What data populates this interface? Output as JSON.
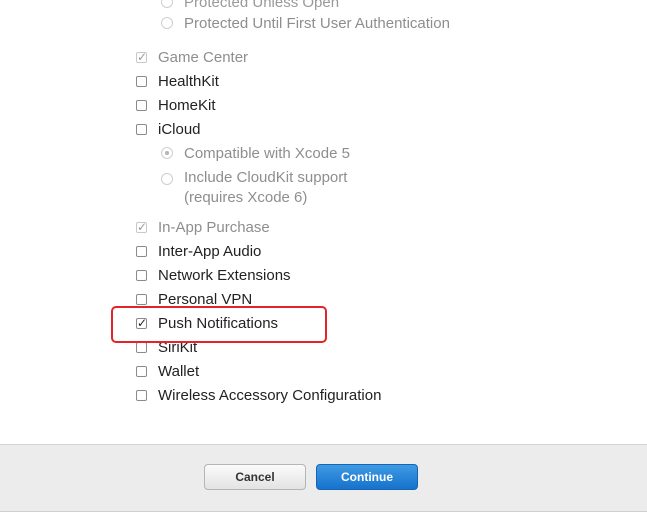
{
  "options": {
    "protected_unless_open": "Protected Unless Open",
    "protected_until_first_auth": "Protected Until First User Authentication",
    "game_center": "Game Center",
    "healthkit": "HealthKit",
    "homekit": "HomeKit",
    "icloud": "iCloud",
    "icloud_compatible": "Compatible with Xcode 5",
    "icloud_cloudkit_line1": "Include CloudKit support",
    "icloud_cloudkit_line2": "(requires Xcode 6)",
    "in_app_purchase": "In-App Purchase",
    "inter_app_audio": "Inter-App Audio",
    "network_extensions": "Network Extensions",
    "personal_vpn": "Personal VPN",
    "push_notifications": "Push Notifications",
    "sirikit": "SiriKit",
    "wallet": "Wallet",
    "wireless_accessory": "Wireless Accessory Configuration"
  },
  "states": {
    "game_center": "checked-disabled",
    "in_app_purchase": "checked-disabled",
    "push_notifications": "checked",
    "icloud_mode": "Compatible with Xcode 5"
  },
  "footer": {
    "cancel_label": "Cancel",
    "continue_label": "Continue"
  },
  "colors": {
    "highlight": "#e0262b",
    "primary_button": "#1a78d2"
  }
}
